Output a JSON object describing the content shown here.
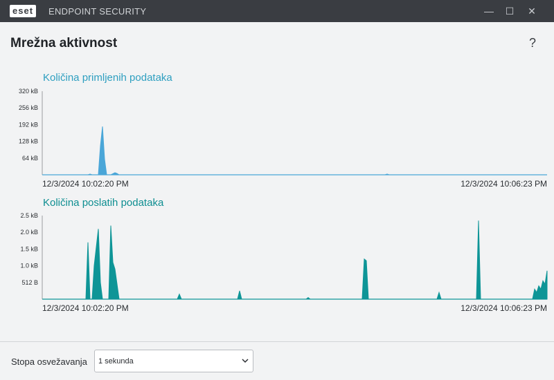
{
  "window": {
    "logo_text": "eset",
    "title": "ENDPOINT SECURITY",
    "minimize_glyph": "—",
    "maximize_glyph": "☐",
    "close_glyph": "✕"
  },
  "page": {
    "title": "Mrežna aktivnost",
    "help_glyph": "?"
  },
  "colors": {
    "received": "#4aa6d8",
    "sent": "#0e9597",
    "titlebar": "#3a3d42"
  },
  "chart_data": [
    {
      "type": "area",
      "title": "Količina primljenih podataka",
      "y_tick_labels": [
        "320 kB",
        "256 kB",
        "192 kB",
        "128 kB",
        "64 kB"
      ],
      "y_ticks": [
        320,
        256,
        192,
        128,
        64
      ],
      "ylim": [
        0,
        320
      ],
      "x_start_label": "12/3/2024 10:02:20 PM",
      "x_end_label": "12/3/2024 10:06:23 PM",
      "duration_s": 243,
      "points": [
        [
          0,
          0
        ],
        [
          22,
          0
        ],
        [
          23,
          3
        ],
        [
          24,
          0
        ],
        [
          27,
          0
        ],
        [
          28,
          110
        ],
        [
          29,
          185
        ],
        [
          30,
          60
        ],
        [
          31,
          0
        ],
        [
          33,
          0
        ],
        [
          34,
          4
        ],
        [
          35,
          8
        ],
        [
          36,
          5
        ],
        [
          37,
          0
        ],
        [
          165,
          0
        ],
        [
          166,
          3
        ],
        [
          167,
          0
        ],
        [
          243,
          0
        ]
      ]
    },
    {
      "type": "area",
      "title": "Količina poslatih podataka",
      "y_tick_labels": [
        "2.5 kB",
        "2.0 kB",
        "1.5 kB",
        "1.0 kB",
        "512 B"
      ],
      "y_ticks": [
        2.5,
        2.0,
        1.5,
        1.0,
        0.5
      ],
      "ylim": [
        0,
        2.5
      ],
      "x_start_label": "12/3/2024 10:02:20 PM",
      "x_end_label": "12/3/2024 10:06:23 PM",
      "duration_s": 243,
      "points": [
        [
          0,
          0
        ],
        [
          21,
          0
        ],
        [
          22,
          1.7
        ],
        [
          23,
          0
        ],
        [
          24,
          0
        ],
        [
          25,
          1.0
        ],
        [
          27,
          2.1
        ],
        [
          28,
          0.5
        ],
        [
          29,
          0
        ],
        [
          32,
          0
        ],
        [
          33,
          2.2
        ],
        [
          34,
          1.1
        ],
        [
          35,
          0.9
        ],
        [
          37,
          0
        ],
        [
          65,
          0
        ],
        [
          66,
          0.15
        ],
        [
          67,
          0
        ],
        [
          94,
          0
        ],
        [
          95,
          0.25
        ],
        [
          96,
          0
        ],
        [
          127,
          0
        ],
        [
          128,
          0.05
        ],
        [
          129,
          0
        ],
        [
          154,
          0
        ],
        [
          155,
          1.2
        ],
        [
          156,
          1.15
        ],
        [
          157,
          0
        ],
        [
          190,
          0
        ],
        [
          191,
          0.2
        ],
        [
          192,
          0
        ],
        [
          209,
          0
        ],
        [
          210,
          2.35
        ],
        [
          211,
          0
        ],
        [
          236,
          0
        ],
        [
          237,
          0.3
        ],
        [
          238,
          0.2
        ],
        [
          239,
          0.4
        ],
        [
          240,
          0.3
        ],
        [
          241,
          0.55
        ],
        [
          242,
          0.45
        ],
        [
          243,
          0.85
        ]
      ]
    }
  ],
  "footer": {
    "refresh_label": "Stopa osvežavanja",
    "refresh_value": "1 sekunda"
  }
}
